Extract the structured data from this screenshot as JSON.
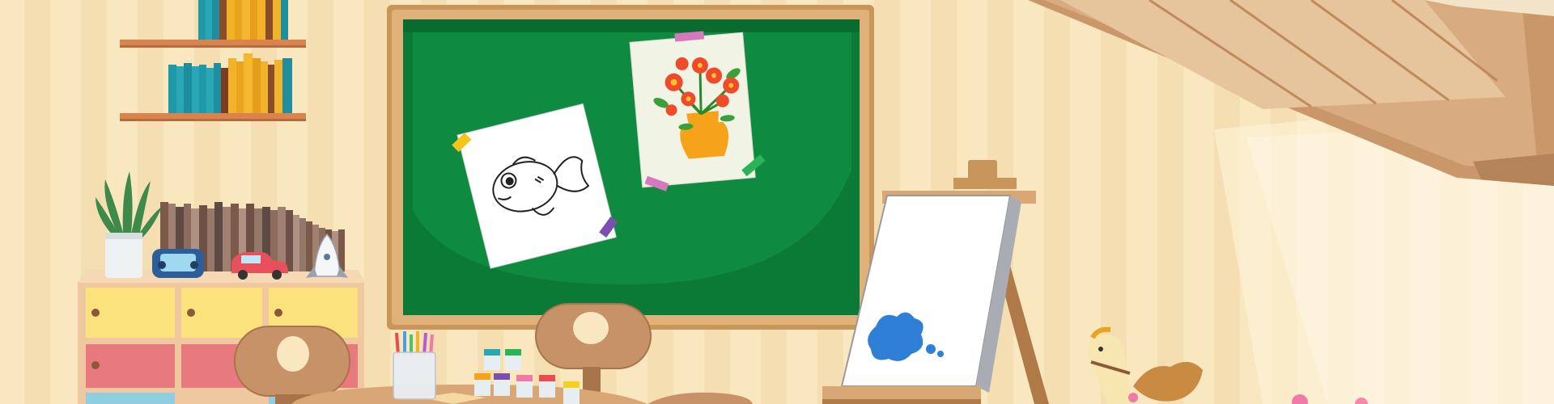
{
  "scene": {
    "kind": "cartoon art classroom illustration",
    "colors": {
      "wall_light": "#f8e7bf",
      "wall_stripe": "#f2d9a8",
      "board_green": "#0a7a36",
      "board_frame": "#c8955a",
      "desk_wood": "#c89268",
      "shelf_wood": "#d9844f",
      "drawer_yellow": "#fbe27c",
      "drawer_pink": "#e87a7f",
      "drawer_blue": "#8fcde0",
      "paint_blue": "#2f7fd6",
      "flower_red": "#f04a2a",
      "vase_orange": "#f7a21b",
      "skylight_wood": "#d6a57a"
    },
    "objects": [
      {
        "name": "bookshelf-top",
        "icon": "books-icon"
      },
      {
        "name": "bookshelf-bottom",
        "icon": "books-icon"
      },
      {
        "name": "chalkboard",
        "icon": "chalkboard-icon"
      },
      {
        "name": "fish-drawing",
        "icon": "fish-icon"
      },
      {
        "name": "flower-vase-drawing",
        "icon": "flower-icon"
      },
      {
        "name": "easel-canvas",
        "icon": "easel-icon"
      },
      {
        "name": "paint-splash",
        "icon": "paint-splash-icon"
      },
      {
        "name": "cactus-pot",
        "icon": "cactus-icon"
      },
      {
        "name": "toy-radio",
        "icon": "radio-icon"
      },
      {
        "name": "toy-car",
        "icon": "car-icon"
      },
      {
        "name": "toy-rocket",
        "icon": "rocket-icon"
      },
      {
        "name": "drawer-cabinet",
        "icon": "cabinet-icon"
      },
      {
        "name": "chair-left",
        "icon": "chair-icon"
      },
      {
        "name": "chair-center",
        "icon": "chair-icon"
      },
      {
        "name": "pencil-cup",
        "icon": "pencil-cup-icon"
      },
      {
        "name": "paint-jars",
        "icon": "paint-jar-icon"
      },
      {
        "name": "rocking-horse",
        "icon": "rocking-horse-icon"
      },
      {
        "name": "skylight-window",
        "icon": "window-icon"
      }
    ]
  }
}
